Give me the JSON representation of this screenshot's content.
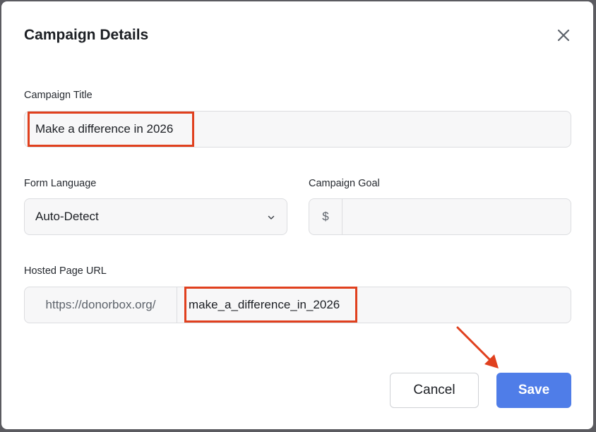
{
  "modal": {
    "title": "Campaign Details"
  },
  "form": {
    "campaign_title": {
      "label": "Campaign Title",
      "value": "Make a difference in 2026"
    },
    "form_language": {
      "label": "Form Language",
      "selected": "Auto-Detect"
    },
    "campaign_goal": {
      "label": "Campaign Goal",
      "currency_symbol": "$",
      "value": ""
    },
    "hosted_page_url": {
      "label": "Hosted Page URL",
      "prefix": "https://donorbox.org/",
      "slug": "make_a_difference_in_2026"
    }
  },
  "actions": {
    "cancel_label": "Cancel",
    "save_label": "Save"
  },
  "colors": {
    "accent": "#4f7de8",
    "annotation": "#e0401e",
    "field_bg": "#f7f7f8"
  },
  "icons": {
    "close": "close-icon",
    "chevron": "chevron-down-icon",
    "annotation_arrow": "arrow-icon"
  }
}
